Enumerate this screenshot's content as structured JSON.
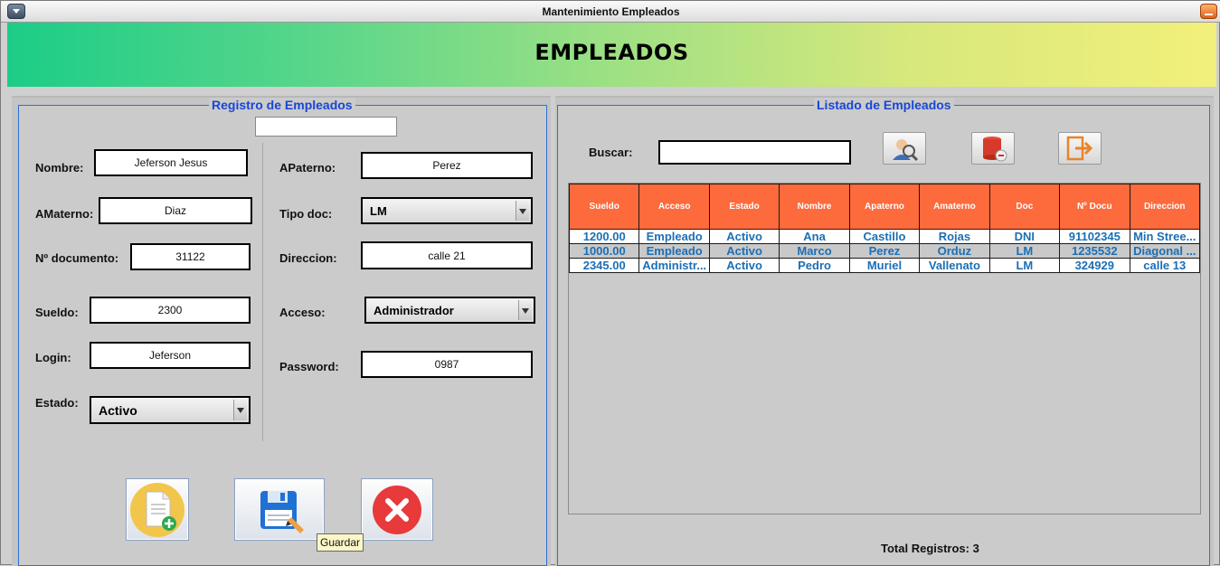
{
  "window": {
    "title": "Mantenimiento Empleados"
  },
  "banner": {
    "title": "EMPLEADOS"
  },
  "registro": {
    "title": "Registro de Empleados",
    "id_field": "",
    "nombre_label": "Nombre:",
    "nombre": "Jeferson Jesus",
    "apaterno_label": "APaterno:",
    "apaterno": "Perez",
    "amaterno_label": "AMaterno:",
    "amaterno": "Diaz",
    "tipodoc_label": "Tipo doc:",
    "tipodoc": "LM",
    "documento_label": "Nº documento:",
    "documento": "31122",
    "direccion_label": "Direccion:",
    "direccion": "calle 21",
    "sueldo_label": "Sueldo:",
    "sueldo": "2300",
    "acceso_label": "Acceso:",
    "acceso": "Administrador",
    "login_label": "Login:",
    "login": "Jeferson",
    "password_label": "Password:",
    "password": "0987",
    "estado_label": "Estado:",
    "estado": "Activo",
    "tooltip": "Guardar"
  },
  "listado": {
    "title": "Listado de Empleados",
    "buscar_label": "Buscar:",
    "buscar_value": "",
    "columns": [
      "Sueldo",
      "Acceso",
      "Estado",
      "Nombre",
      "Apaterno",
      "Amaterno",
      "Doc",
      "Nº Docu",
      "Direccion"
    ],
    "rows": [
      [
        "1200.00",
        "Empleado",
        "Activo",
        "Ana",
        "Castillo",
        "Rojas",
        "DNI",
        "91102345",
        "Min Stree..."
      ],
      [
        "1000.00",
        "Empleado",
        "Activo",
        "Marco",
        "Perez",
        "Orduz",
        "LM",
        "1235532",
        "Diagonal ..."
      ],
      [
        "2345.00",
        "Administr...",
        "Activo",
        "Pedro",
        "Muriel",
        "Vallenato",
        "LM",
        "324929",
        "calle 13"
      ]
    ],
    "total": "Total Registros: 3"
  }
}
